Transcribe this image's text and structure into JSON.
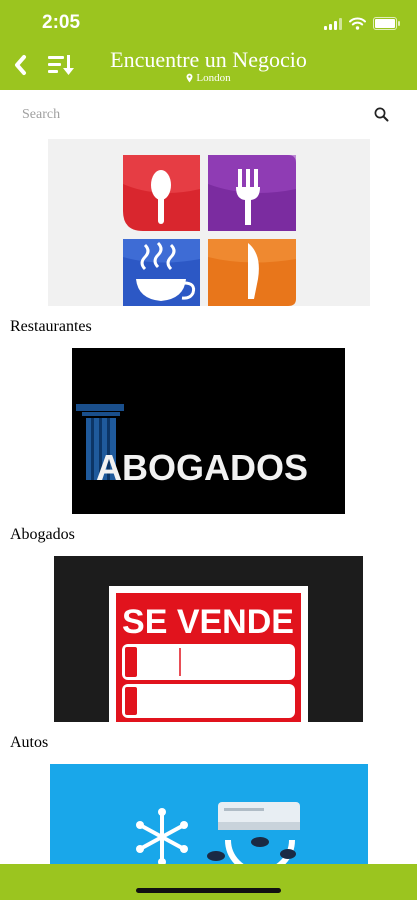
{
  "status_bar": {
    "time": "2:05"
  },
  "header": {
    "title": "Encuentre un Negocio",
    "location": "London",
    "colors": {
      "accent": "#9bc51f"
    }
  },
  "search": {
    "placeholder": "Search"
  },
  "categories": [
    {
      "label": "Restaurantes",
      "image": "restaurant-icons-image"
    },
    {
      "label": "Abogados",
      "image": "abogados-logo-image",
      "image_text": "ABOGADOS"
    },
    {
      "label": "Autos",
      "image": "se-vende-sign-image",
      "image_text": "SE VENDE"
    },
    {
      "label": "",
      "image": "air-conditioning-image"
    }
  ]
}
